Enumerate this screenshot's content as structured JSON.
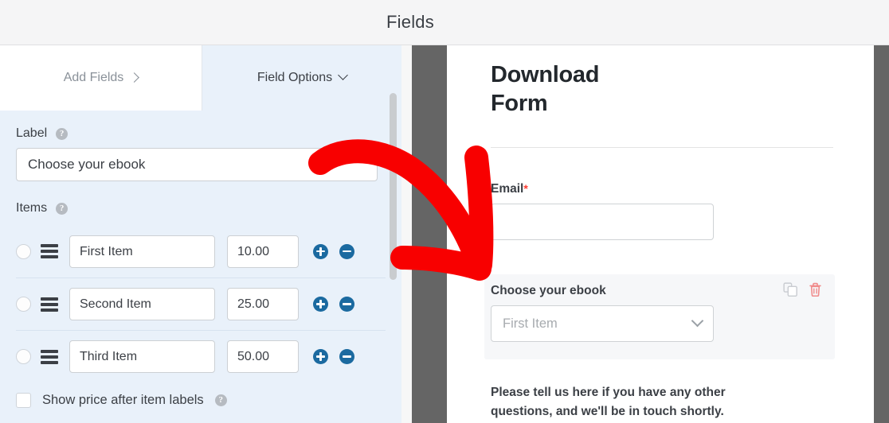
{
  "header": {
    "title": "Fields"
  },
  "tabs": [
    {
      "label": "Add Fields",
      "icon": "chevron-right-icon",
      "active": false
    },
    {
      "label": "Field Options",
      "icon": "chevron-down-icon",
      "active": true
    }
  ],
  "field_options": {
    "label_section": {
      "label": "Label",
      "help_icon": "question-mark-icon",
      "value": "Choose your ebook",
      "placeholder": ""
    },
    "items_section": {
      "label": "Items",
      "help_icon": "question-mark-icon",
      "items": [
        {
          "radio": "radio-unselected",
          "handle": "drag-handle-icon",
          "text": "First Item",
          "price": "10.00",
          "add": "plus-circle-icon",
          "remove": "minus-circle-icon"
        },
        {
          "radio": "radio-unselected",
          "handle": "drag-handle-icon",
          "text": "Second Item",
          "price": "25.00",
          "add": "plus-circle-icon",
          "remove": "minus-circle-icon"
        },
        {
          "radio": "radio-unselected",
          "handle": "drag-handle-icon",
          "text": "Third Item",
          "price": "50.00",
          "add": "plus-circle-icon",
          "remove": "minus-circle-icon"
        }
      ]
    },
    "show_price_checkbox": {
      "label": "Show price after item labels",
      "checked": false,
      "help_icon": "question-mark-icon"
    }
  },
  "preview": {
    "form_title": "Download\nForm",
    "form_title_line1": "Download",
    "form_title_line2": "Form",
    "email_field": {
      "label": "Email",
      "required_marker": "*",
      "value": ""
    },
    "dropdown_field": {
      "label": "Choose your ebook",
      "selected": "First Item",
      "chevron": "chevron-down-icon",
      "duplicate_icon": "duplicate-icon",
      "delete_icon": "trash-icon"
    },
    "paragraph": "Please tell us here if you have any other questions, and we'll be in touch shortly."
  },
  "colors": {
    "panel_bg": "#e9f1fa",
    "tab_inactive_bg": "#ffffff",
    "accent_blue": "#1b6aa0",
    "required_red": "#ff3b30",
    "delete_red": "#f08b8b",
    "annotation_red": "#f80000",
    "gutter": "#656565",
    "active_field_bg": "#f6f7f9"
  },
  "annotation": {
    "type": "arrow",
    "color": "#f80000",
    "description": "curved-red-arrow-pointing-to-dropdown-field"
  }
}
